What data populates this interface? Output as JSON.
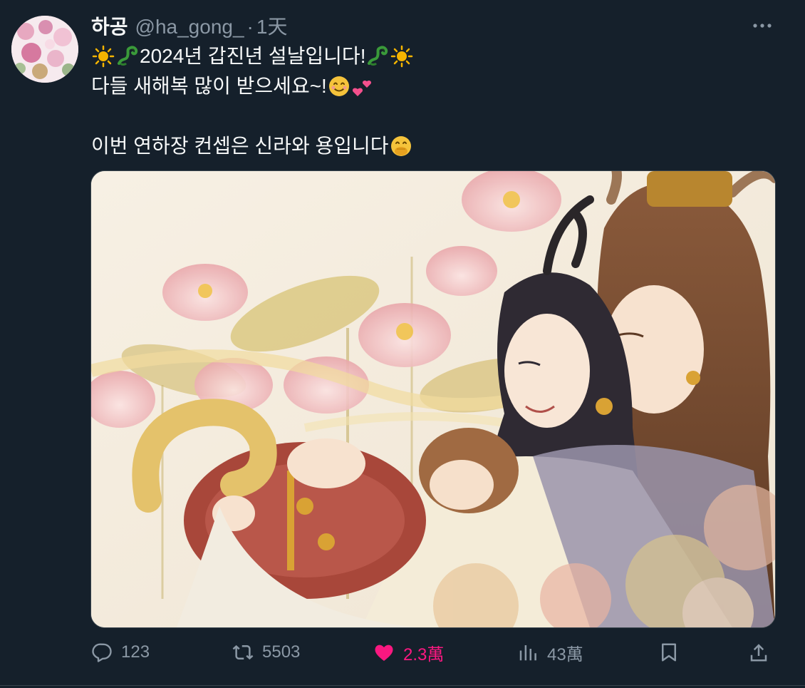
{
  "user": {
    "display_name": "하공",
    "handle": "@ha_gong_",
    "separator": "·",
    "time": "1天",
    "avatar_icon": "avatar-image"
  },
  "tweet": {
    "line1_text": "2024년 갑진년 설날입니다!",
    "line2_text": "다들 새해복 많이 받으세요~!",
    "line3_text": "이번 연하장 컨셉은 신라와 용입니다",
    "emoji": [
      "sun-emoji",
      "dragon-emoji",
      "smiling-face-emoji",
      "two-hearts-emoji",
      "face-with-hand-over-mouth-emoji"
    ]
  },
  "media": {
    "icon": "illustration-image"
  },
  "actions": {
    "reply": {
      "icon": "reply-icon",
      "count": "123"
    },
    "retweet": {
      "icon": "retweet-icon",
      "count": "5503"
    },
    "like": {
      "icon": "heart-icon",
      "count": "2.3萬",
      "liked": true
    },
    "views": {
      "icon": "views-icon",
      "count": "43萬"
    },
    "bookmark": {
      "icon": "bookmark-icon"
    },
    "share": {
      "icon": "share-icon"
    }
  },
  "colors": {
    "background": "#15202b",
    "text_primary": "#f7f9f9",
    "text_secondary": "#8b98a5",
    "like_pink": "#f91880",
    "border": "#38444d"
  }
}
